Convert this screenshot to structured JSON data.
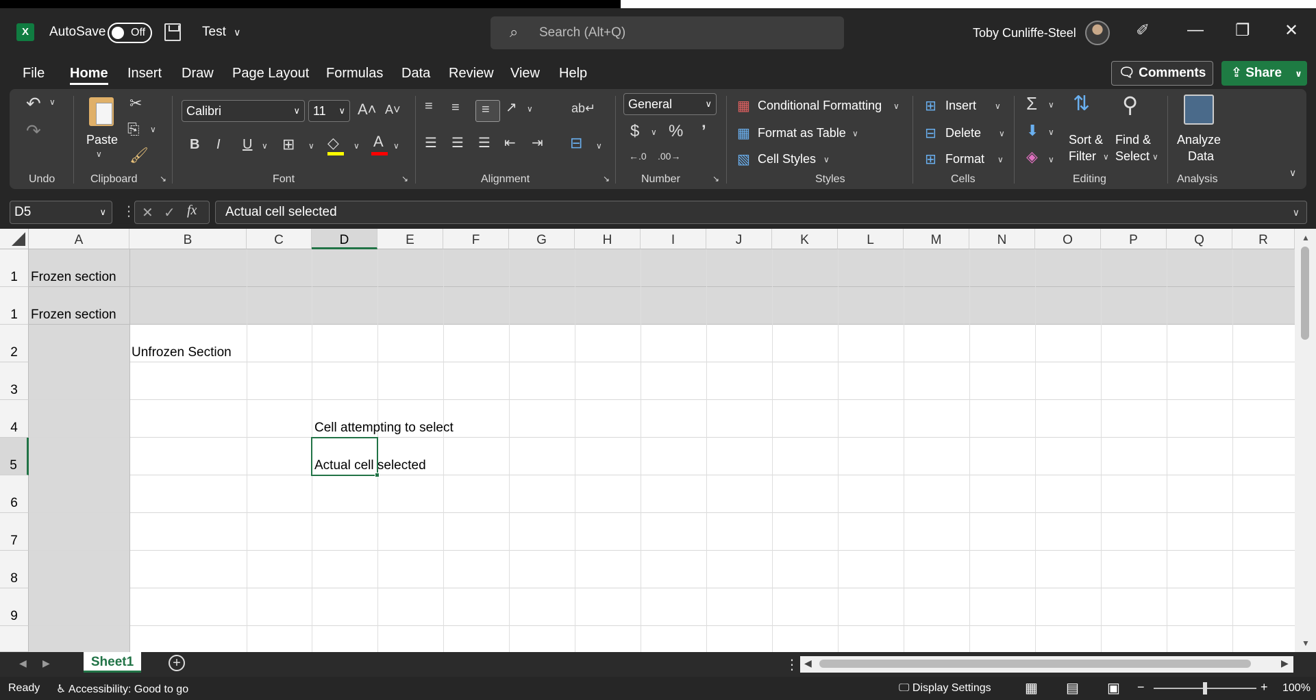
{
  "titlebar": {
    "autosave_label": "AutoSave",
    "autosave_state": "Off",
    "doc_title": "Test",
    "search_placeholder": "Search (Alt+Q)",
    "user_name": "Toby Cunliffe-Steel"
  },
  "tabs": [
    "File",
    "Home",
    "Insert",
    "Draw",
    "Page Layout",
    "Formulas",
    "Data",
    "Review",
    "View",
    "Help"
  ],
  "active_tab": "Home",
  "actions": {
    "comments": "Comments",
    "share": "Share"
  },
  "ribbon": {
    "undo_group": "Undo",
    "clipboard_group": "Clipboard",
    "paste": "Paste",
    "font_group": "Font",
    "font_name": "Calibri",
    "font_size": "11",
    "bold": "B",
    "italic": "I",
    "underline": "U",
    "alignment_group": "Alignment",
    "number_group": "Number",
    "number_format": "General",
    "styles_group": "Styles",
    "conditional_formatting": "Conditional Formatting",
    "format_as_table": "Format as Table",
    "cell_styles": "Cell Styles",
    "cells_group": "Cells",
    "insert": "Insert",
    "delete": "Delete",
    "format": "Format",
    "editing_group": "Editing",
    "sort_filter_1": "Sort &",
    "sort_filter_2": "Filter",
    "find_select_1": "Find &",
    "find_select_2": "Select",
    "analysis_group": "Analysis",
    "analyze_1": "Analyze",
    "analyze_2": "Data",
    "accent": "#107c41",
    "highlight_color": "#ffff00",
    "font_color": "#ff0000"
  },
  "formula_bar": {
    "name_box": "D5",
    "fx": "fx",
    "content": "Actual cell selected"
  },
  "grid": {
    "columns": [
      "A",
      "B",
      "C",
      "D",
      "E",
      "F",
      "G",
      "H",
      "I",
      "J",
      "K",
      "L",
      "M",
      "N",
      "O",
      "P",
      "Q",
      "R"
    ],
    "selected_column": "D",
    "rows": [
      "1",
      "1",
      "2",
      "3",
      "4",
      "5",
      "6",
      "7",
      "8",
      "9"
    ],
    "selected_row": "5",
    "cells": {
      "a1_top": "Frozen section",
      "a1_bottom": "Frozen section",
      "b2": "Unfrozen Section",
      "d4": "Cell attempting to select",
      "d5": "Actual cell selected"
    }
  },
  "sheets": {
    "active": "Sheet1"
  },
  "status": {
    "ready": "Ready",
    "accessibility": "Accessibility: Good to go",
    "display_settings": "Display Settings",
    "zoom": "100%"
  }
}
